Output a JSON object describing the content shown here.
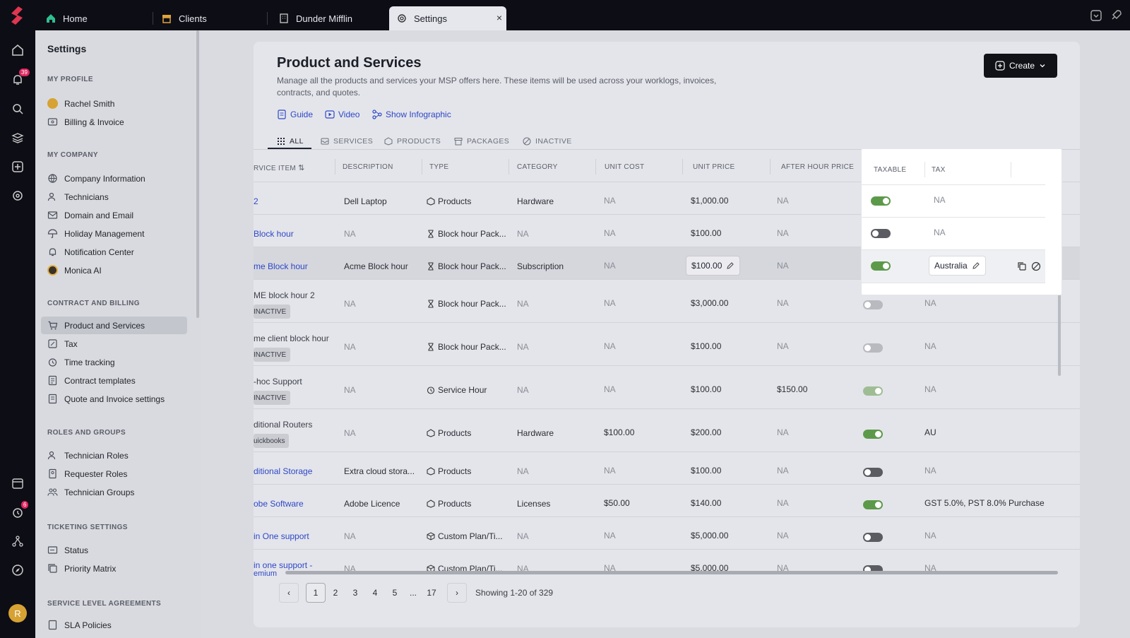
{
  "topbar": {
    "tabs": [
      {
        "label": "Home",
        "icon": "home-icon"
      },
      {
        "label": "Clients",
        "icon": "store-icon"
      },
      {
        "label": "Dunder Mifflin",
        "icon": "building-icon"
      },
      {
        "label": "Settings",
        "icon": "gear-icon"
      }
    ],
    "close_glyph": "×"
  },
  "rail": {
    "notification_badge": "39",
    "timer_badge": "6",
    "avatar_initial": "R"
  },
  "sidebar": {
    "title": "Settings",
    "sections": {
      "my_profile": "MY PROFILE",
      "my_company": "MY COMPANY",
      "contract_billing": "CONTRACT AND BILLING",
      "roles_groups": "ROLES AND GROUPS",
      "ticketing": "TICKETING SETTINGS",
      "sla": "SERVICE LEVEL AGREEMENTS"
    },
    "profile_items": [
      "Rachel Smith",
      "Billing & Invoice"
    ],
    "company_items": [
      "Company Information",
      "Technicians",
      "Domain and Email",
      "Holiday Management",
      "Notification Center",
      "Monica AI"
    ],
    "billing_items": [
      "Product and Services",
      "Tax",
      "Time tracking",
      "Contract templates",
      "Quote and Invoice settings"
    ],
    "roles_items": [
      "Technician Roles",
      "Requester Roles",
      "Technician Groups"
    ],
    "ticketing_items": [
      "Status",
      "Priority Matrix"
    ],
    "sla_items": [
      "SLA Policies"
    ]
  },
  "page": {
    "title": "Product and Services",
    "description": "Manage all the products and services your MSP offers here. These items will be used across your worklogs, invoices, contracts, and quotes.",
    "create_label": "Create",
    "help_links": [
      "Guide",
      "Video",
      "Show Infographic"
    ],
    "filter_tabs": [
      "ALL",
      "SERVICES",
      "PRODUCTS",
      "PACKAGES",
      "INACTIVE"
    ]
  },
  "table": {
    "headers": [
      "RVICE ITEM",
      "DESCRIPTION",
      "TYPE",
      "CATEGORY",
      "UNIT COST",
      "UNIT PRICE",
      "AFTER HOUR PRICE",
      "TAXABLE",
      "TAX"
    ],
    "rows": [
      {
        "name": "2",
        "tag": "",
        "desc": "Dell Laptop",
        "type": "Products",
        "type_icon": "product-icon",
        "category": "Hardware",
        "cost": "NA",
        "price": "$1,000.00",
        "after": "NA",
        "tax": "NA"
      },
      {
        "name": "Block hour",
        "tag": "",
        "desc": "NA",
        "type": "Block hour Pack...",
        "type_icon": "hourglass-icon",
        "category": "NA",
        "cost": "NA",
        "price": "$100.00",
        "after": "NA",
        "tax": "NA"
      },
      {
        "name": "me Block hour",
        "tag": "",
        "desc": "Acme Block hour",
        "type": "Block hour Pack...",
        "type_icon": "hourglass-icon",
        "category": "Subscription",
        "cost": "NA",
        "price": "$100.00",
        "after": "NA",
        "tax": "Australia"
      },
      {
        "name": "ME block hour 2",
        "tag": "INACTIVE",
        "desc": "NA",
        "type": "Block hour Pack...",
        "type_icon": "hourglass-icon",
        "category": "NA",
        "cost": "NA",
        "price": "$3,000.00",
        "after": "NA",
        "tax": "NA"
      },
      {
        "name": "me client block hour",
        "tag": "INACTIVE",
        "desc": "NA",
        "type": "Block hour Pack...",
        "type_icon": "hourglass-icon",
        "category": "NA",
        "cost": "NA",
        "price": "$100.00",
        "after": "NA",
        "tax": "NA"
      },
      {
        "name": "-hoc Support",
        "tag": "INACTIVE",
        "desc": "NA",
        "type": "Service Hour",
        "type_icon": "clock-icon",
        "category": "NA",
        "cost": "NA",
        "price": "$100.00",
        "after": "$150.00",
        "tax": "NA"
      },
      {
        "name": "ditional Routers",
        "tag": "uickbooks",
        "desc": "NA",
        "type": "Products",
        "type_icon": "product-icon",
        "category": "Hardware",
        "cost": "$100.00",
        "price": "$200.00",
        "after": "NA",
        "tax": "AU"
      },
      {
        "name": "ditional Storage",
        "tag": "",
        "desc": "Extra cloud stora...",
        "type": "Products",
        "type_icon": "product-icon",
        "category": "NA",
        "cost": "NA",
        "price": "$100.00",
        "after": "NA",
        "tax": "NA"
      },
      {
        "name": "obe Software",
        "tag": "",
        "desc": "Adobe Licence",
        "type": "Products",
        "type_icon": "product-icon",
        "category": "Licenses",
        "cost": "$50.00",
        "price": "$140.00",
        "after": "NA",
        "tax": "GST 5.0%, PST 8.0% Purchase"
      },
      {
        "name": "in One support",
        "tag": "",
        "desc": "NA",
        "type": "Custom Plan/Ti...",
        "type_icon": "box-icon",
        "category": "NA",
        "cost": "NA",
        "price": "$5,000.00",
        "after": "NA",
        "tax": "NA"
      },
      {
        "name": "in one support -",
        "name2": "emium",
        "tag": "",
        "desc": "NA",
        "type": "Custom Plan/Ti...",
        "type_icon": "box-icon",
        "category": "NA",
        "cost": "NA",
        "price": "$5,000.00",
        "after": "NA",
        "tax": "NA"
      }
    ]
  },
  "pagination": {
    "pages": [
      "1",
      "2",
      "3",
      "4",
      "5",
      "...",
      "17"
    ],
    "prev": "‹",
    "next": "›",
    "showing": "Showing 1-20 of 329"
  }
}
